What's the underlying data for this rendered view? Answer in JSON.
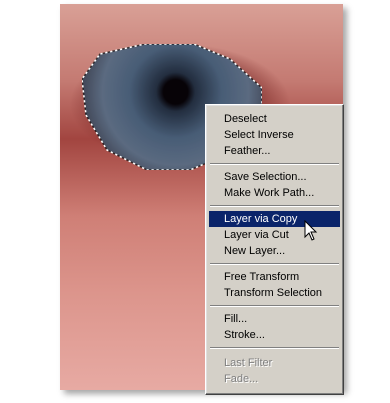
{
  "context_menu": {
    "groups": [
      [
        "Deselect",
        "Select Inverse",
        "Feather..."
      ],
      [
        "Save Selection...",
        "Make Work Path..."
      ],
      [
        "Layer via Copy",
        "Layer via Cut",
        "New Layer..."
      ],
      [
        "Free Transform",
        "Transform Selection"
      ],
      [
        "Fill...",
        "Stroke..."
      ],
      [
        "Last Filter",
        "Fade..."
      ]
    ],
    "highlighted_item": "Layer via Copy",
    "disabled_items": [
      "Last Filter",
      "Fade..."
    ],
    "highlight_color": "#0a246a",
    "menu_bg_color": "#d4d0c8"
  },
  "icons": {
    "cursor": "arrow-pointer-icon",
    "selection": "marching-ants-selection"
  }
}
